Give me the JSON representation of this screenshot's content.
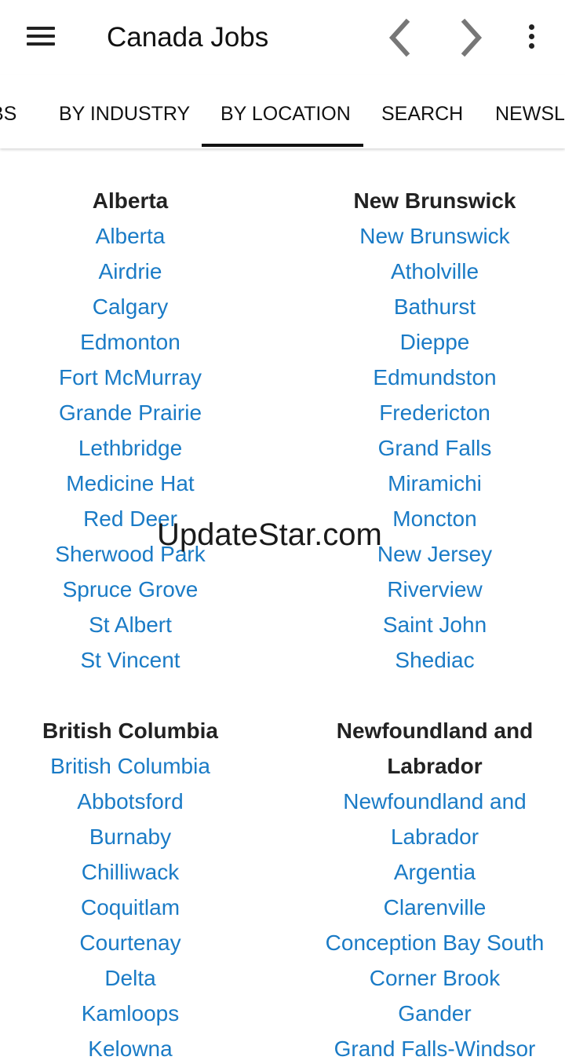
{
  "appbar": {
    "title": "Canada Jobs",
    "menu_icon": "hamburger-menu-icon",
    "back_icon": "chevron-left-icon",
    "forward_icon": "chevron-right-icon",
    "overflow_icon": "more-vert-icon"
  },
  "tabs": {
    "jobs": "BS",
    "industry": "BY INDUSTRY",
    "location": "BY LOCATION",
    "search": "SEARCH",
    "newsletter": "NEWSLI",
    "active": "BY LOCATION"
  },
  "colors": {
    "link": "#1a7bc6",
    "heading": "#222222",
    "indicator": "#111111"
  },
  "sections": {
    "alberta": {
      "title": "Alberta",
      "items": [
        "Alberta",
        "Airdrie",
        "Calgary",
        "Edmonton",
        "Fort McMurray",
        "Grande Prairie",
        "Lethbridge",
        "Medicine Hat",
        "Red Deer",
        "Sherwood Park",
        "Spruce Grove",
        "St Albert",
        "St Vincent"
      ]
    },
    "new_brunswick": {
      "title": "New Brunswick",
      "items": [
        "New Brunswick",
        "Atholville",
        "Bathurst",
        "Dieppe",
        "Edmundston",
        "Fredericton",
        "Grand Falls",
        "Miramichi",
        "Moncton",
        "New Jersey",
        "Riverview",
        "Saint John",
        "Shediac"
      ]
    },
    "british_columbia": {
      "title": "British Columbia",
      "items": [
        "British Columbia",
        "Abbotsford",
        "Burnaby",
        "Chilliwack",
        "Coquitlam",
        "Courtenay",
        "Delta",
        "Kamloops",
        "Kelowna"
      ]
    },
    "newfoundland": {
      "title_line1": "Newfoundland and",
      "title_line2": "Labrador",
      "item_line1": "Newfoundland and",
      "item_line2": "Labrador",
      "items": [
        "Argentia",
        "Clarenville",
        "Conception Bay South",
        "Corner Brook",
        "Gander",
        "Grand Falls-Windsor"
      ]
    }
  },
  "watermark": "UpdateStar.com"
}
